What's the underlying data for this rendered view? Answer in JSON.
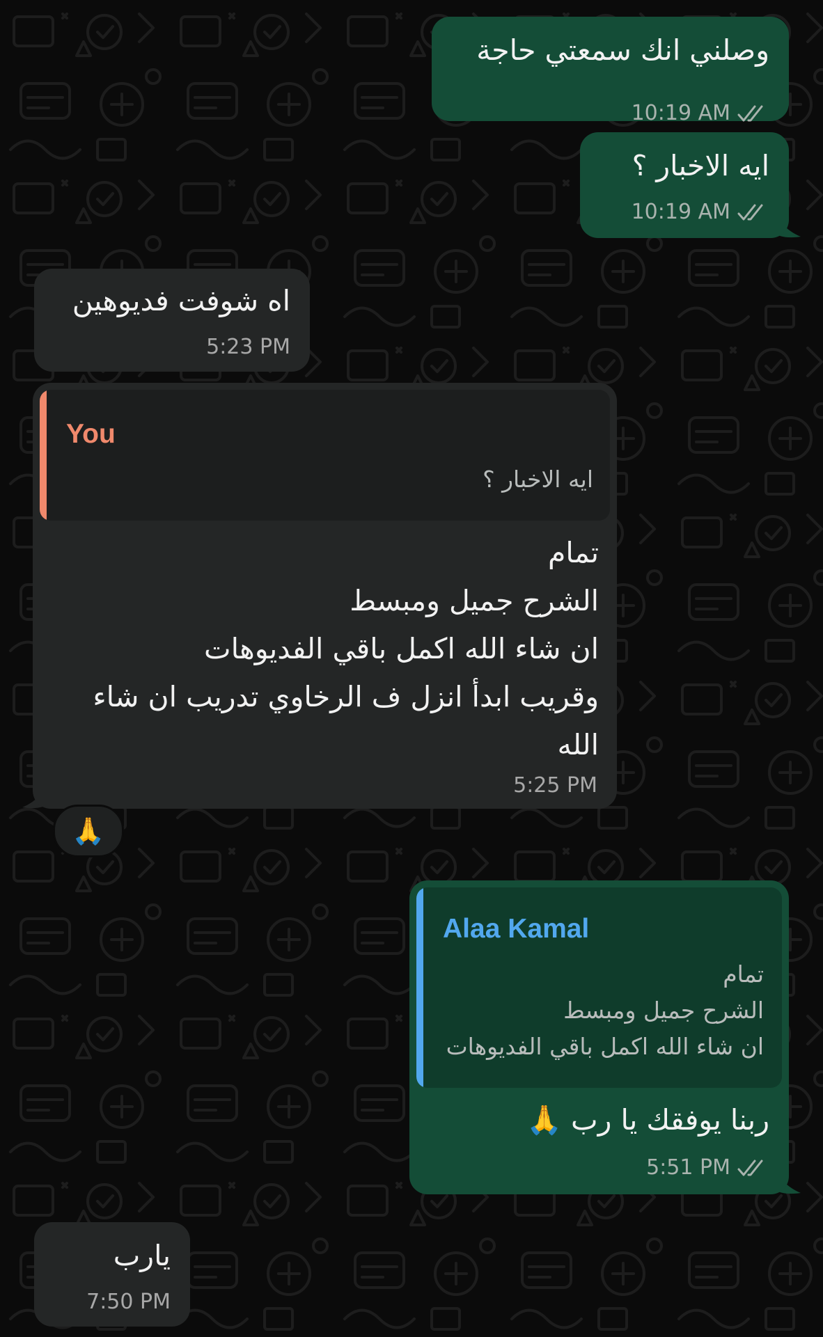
{
  "theme": {
    "background": "#0b0b0b",
    "outgoing_bubble": "#144d37",
    "incoming_bubble": "#242626",
    "reply_you_color": "#f0896c",
    "reply_alaa_color": "#52a8ee"
  },
  "messages": [
    {
      "id": "m1",
      "direction": "outgoing",
      "text": "وصلني انك سمعتي حاجة",
      "time": "10:19 AM",
      "status": "read"
    },
    {
      "id": "m2",
      "direction": "outgoing",
      "text": "ايه الاخبار ؟",
      "time": "10:19 AM",
      "status": "read"
    },
    {
      "id": "m3",
      "direction": "incoming",
      "text": "اه شوفت فديوهين",
      "time": "5:23 PM"
    },
    {
      "id": "m4",
      "direction": "incoming",
      "reply": {
        "author": "You",
        "text": "ايه الاخبار ؟"
      },
      "lines": [
        "تمام",
        "الشرح جميل ومبسط ",
        "ان شاء الله اكمل باقي الفديوهات",
        "وقريب ابدأ انزل ف الرخاوي تدريب ان شاء",
        "الله"
      ],
      "time": "5:25 PM",
      "reaction": "🙏"
    },
    {
      "id": "m5",
      "direction": "outgoing",
      "reply": {
        "author": "Alaa Kamal",
        "lines": [
          "تمام",
          "الشرح جميل ومبسط ",
          "ان شاء الله اكمل باقي الفديوهات"
        ]
      },
      "text": "ربنا يوفقك يا رب 🙏",
      "time": "5:51 PM",
      "status": "read"
    },
    {
      "id": "m6",
      "direction": "incoming",
      "text": "يارب",
      "time": "7:50 PM"
    }
  ],
  "icons": {
    "read_receipt": "double-check-icon",
    "wallpaper": "doodle-pattern"
  }
}
